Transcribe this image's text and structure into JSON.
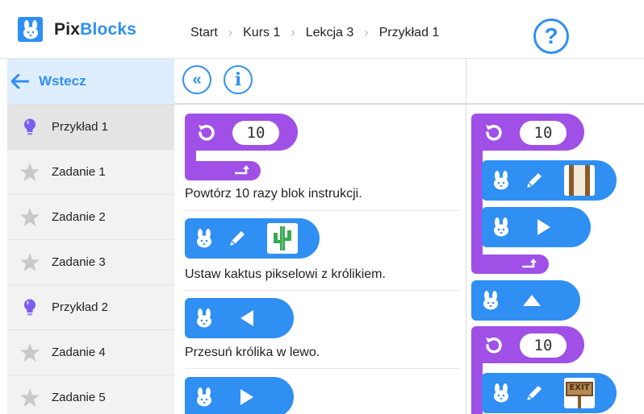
{
  "header": {
    "logo_pix": "Pix",
    "logo_blocks": "Blocks",
    "breadcrumb": [
      "Start",
      "Kurs 1",
      "Lekcja 3",
      "Przykład 1"
    ],
    "help_label": "?"
  },
  "sidebar": {
    "back_label": "Wstecz",
    "items": [
      {
        "label": "Przykład 1",
        "icon": "lightbulb-icon"
      },
      {
        "label": "Zadanie 1",
        "icon": "star-icon"
      },
      {
        "label": "Zadanie 2",
        "icon": "star-icon"
      },
      {
        "label": "Zadanie 3",
        "icon": "star-icon"
      },
      {
        "label": "Przykład 2",
        "icon": "lightbulb-icon"
      },
      {
        "label": "Zadanie 4",
        "icon": "star-icon"
      },
      {
        "label": "Zadanie 5",
        "icon": "star-icon"
      }
    ]
  },
  "toolbar": {
    "collapse_label": "«",
    "info_label": "i"
  },
  "examples": {
    "repeat_count": "10",
    "items": [
      {
        "caption": "Powtórz 10 razy blok instrukcji."
      },
      {
        "caption": "Ustaw kaktus pikselowi z królikiem."
      },
      {
        "caption": "Przesuń królika w lewo."
      }
    ]
  },
  "program": {
    "loop1_count": "10",
    "loop2_count": "10",
    "exit_sign": "EXIT"
  },
  "colors": {
    "blue": "#2f8ff3",
    "purple": "#a050e6",
    "sidebar_active": "#e4e4e4",
    "back_bg": "#dfeeff"
  }
}
